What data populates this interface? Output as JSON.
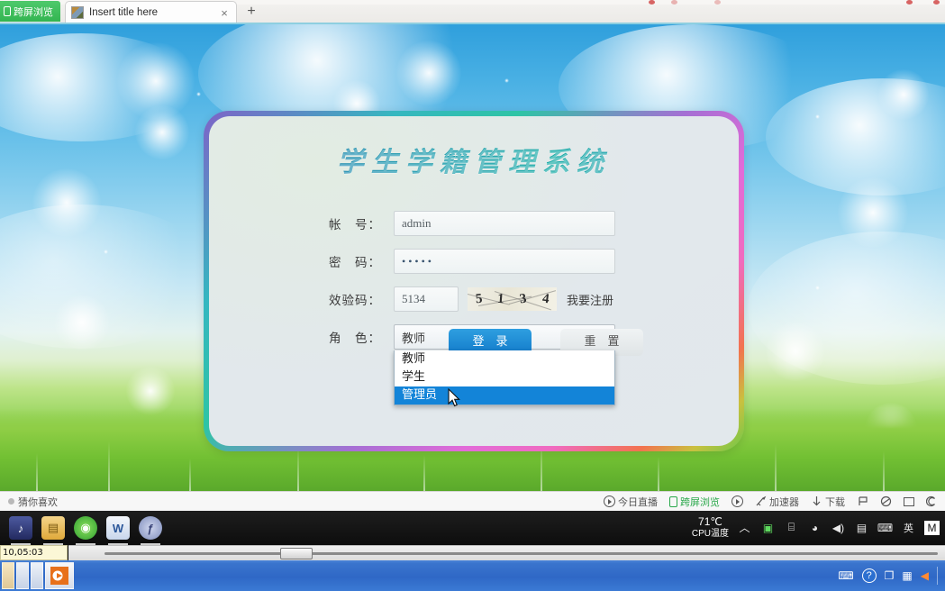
{
  "browser": {
    "kuaping_label": "跨屏浏览",
    "tab_title": "Insert title here",
    "tab_close": "×",
    "new_tab": "+"
  },
  "login": {
    "title": "学生学籍管理系统",
    "fields": {
      "account_label": "帐　号：",
      "account_value": "admin",
      "password_label": "密　码：",
      "password_value": "•••••",
      "captcha_label": "效验码：",
      "captcha_value": "5134",
      "captcha_image_text": "5134",
      "captcha_digits": [
        "5",
        "1",
        "3",
        "4"
      ],
      "register_link": "我要注册",
      "role_label": "角　色：",
      "role_value": "教师",
      "role_caret": "▼"
    },
    "role_options": [
      {
        "label": "教师",
        "selected": false
      },
      {
        "label": "学生",
        "selected": false
      },
      {
        "label": "管理员",
        "selected": true
      }
    ],
    "buttons": {
      "submit": "登　录",
      "reset": "重　置"
    },
    "colors": {
      "title_color": "#1794ad",
      "highlight": "#1384d8"
    }
  },
  "statusbar": {
    "left_label": "猜你喜欢",
    "items": [
      {
        "label": "今日直播",
        "icon": "play-circle-icon",
        "green": false
      },
      {
        "label": "跨屏浏览",
        "icon": "phone-icon",
        "green": true
      },
      {
        "label": "",
        "icon": "clock-icon",
        "green": false
      },
      {
        "label": "加速器",
        "icon": "rocket-icon",
        "green": false
      },
      {
        "label": "下载",
        "icon": "download-arrow-icon",
        "green": false
      },
      {
        "label": "",
        "icon": "flag-icon",
        "green": false
      },
      {
        "label": "",
        "icon": "shield-icon",
        "green": false
      },
      {
        "label": "",
        "icon": "window-icon",
        "green": false
      },
      {
        "label": "",
        "icon": "moon-icon",
        "green": false
      }
    ]
  },
  "taskbar": {
    "apps": [
      {
        "name": "media-player-icon",
        "glyph": "♪",
        "color": "#2a2f6b"
      },
      {
        "name": "file-explorer-icon",
        "glyph": "▤",
        "color": "#e8b33c"
      },
      {
        "name": "browser-icon",
        "glyph": "◉",
        "color": "#3cbb4a"
      },
      {
        "name": "word-icon",
        "glyph": "W",
        "color": "#2a5699"
      },
      {
        "name": "tool-icon",
        "glyph": "ƒ",
        "color": "#8f9bc6"
      }
    ],
    "cpu_temp_value": "71℃",
    "cpu_temp_label": "CPU温度",
    "tray": [
      {
        "name": "show-hidden-icons",
        "glyph": "︿"
      },
      {
        "name": "green-shield-icon",
        "glyph": "▣"
      },
      {
        "name": "screenshot-icon",
        "glyph": "⌸"
      },
      {
        "name": "wifi-icon",
        "glyph": "◕"
      },
      {
        "name": "volume-icon",
        "glyph": "◀)"
      },
      {
        "name": "message-icon",
        "glyph": "▤"
      },
      {
        "name": "keyboard-icon",
        "glyph": "⌨"
      },
      {
        "name": "ime-icon",
        "glyph": "英"
      },
      {
        "name": "extra-icon",
        "glyph": "M"
      }
    ]
  },
  "bottom": {
    "time_tooltip": "10,05:03",
    "tray": [
      {
        "name": "keyboard-icon",
        "glyph": "⌨"
      },
      {
        "name": "help-icon",
        "glyph": "?"
      },
      {
        "name": "windows-icon",
        "glyph": "❐"
      },
      {
        "name": "camera-icon",
        "glyph": "▦"
      },
      {
        "name": "volume-icon",
        "glyph": "◀"
      }
    ]
  }
}
